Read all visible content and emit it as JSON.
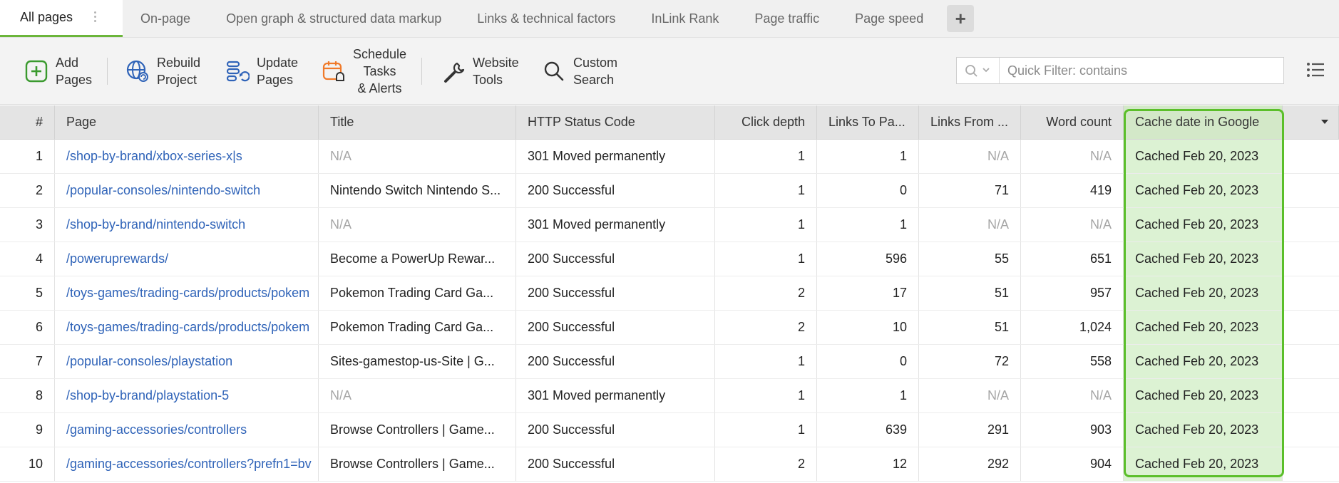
{
  "tabs": [
    {
      "label": "All pages",
      "active": true
    },
    {
      "label": "On-page"
    },
    {
      "label": "Open graph & structured data markup"
    },
    {
      "label": "Links & technical factors"
    },
    {
      "label": "InLink Rank"
    },
    {
      "label": "Page traffic"
    },
    {
      "label": "Page speed"
    }
  ],
  "toolbar": {
    "add_pages": [
      "Add",
      "Pages"
    ],
    "rebuild_project": [
      "Rebuild",
      "Project"
    ],
    "update_pages": [
      "Update",
      "Pages"
    ],
    "schedule": [
      "Schedule",
      "Tasks",
      "& Alerts"
    ],
    "website_tools": [
      "Website",
      "Tools"
    ],
    "custom_search": [
      "Custom",
      "Search"
    ],
    "filter_placeholder": "Quick Filter: contains"
  },
  "colors": {
    "accent": "#6bb53a",
    "link": "#2f63b8",
    "highlight_border": "#5bbf2a",
    "highlight_fill": "#dcf2d3"
  },
  "table": {
    "columns": [
      "#",
      "Page",
      "Title",
      "HTTP Status Code",
      "Click depth",
      "Links To Pa...",
      "Links From ...",
      "Word count",
      "Cache date in Google"
    ],
    "rows": [
      {
        "num": "1",
        "page": "/shop-by-brand/xbox-series-x|s",
        "title": "N/A",
        "http": "301 Moved permanently",
        "depth": "1",
        "lto": "1",
        "lfrom": "N/A",
        "wc": "N/A",
        "cache": "Cached Feb 20, 2023"
      },
      {
        "num": "2",
        "page": "/popular-consoles/nintendo-switch",
        "title": "Nintendo Switch Nintendo S...",
        "http": "200 Successful",
        "depth": "1",
        "lto": "0",
        "lfrom": "71",
        "wc": "419",
        "cache": "Cached Feb 20, 2023"
      },
      {
        "num": "3",
        "page": "/shop-by-brand/nintendo-switch",
        "title": "N/A",
        "http": "301 Moved permanently",
        "depth": "1",
        "lto": "1",
        "lfrom": "N/A",
        "wc": "N/A",
        "cache": "Cached Feb 20, 2023"
      },
      {
        "num": "4",
        "page": "/poweruprewards/",
        "title": "Become a PowerUp Rewar...",
        "http": "200 Successful",
        "depth": "1",
        "lto": "596",
        "lfrom": "55",
        "wc": "651",
        "cache": "Cached Feb 20, 2023"
      },
      {
        "num": "5",
        "page": "/toys-games/trading-cards/products/pokem",
        "title": "Pokemon Trading Card Ga...",
        "http": "200 Successful",
        "depth": "2",
        "lto": "17",
        "lfrom": "51",
        "wc": "957",
        "cache": "Cached Feb 20, 2023"
      },
      {
        "num": "6",
        "page": "/toys-games/trading-cards/products/pokem",
        "title": "Pokemon Trading Card Ga...",
        "http": "200 Successful",
        "depth": "2",
        "lto": "10",
        "lfrom": "51",
        "wc": "1,024",
        "cache": "Cached Feb 20, 2023"
      },
      {
        "num": "7",
        "page": "/popular-consoles/playstation",
        "title": "Sites-gamestop-us-Site | G...",
        "http": "200 Successful",
        "depth": "1",
        "lto": "0",
        "lfrom": "72",
        "wc": "558",
        "cache": "Cached Feb 20, 2023"
      },
      {
        "num": "8",
        "page": "/shop-by-brand/playstation-5",
        "title": "N/A",
        "http": "301 Moved permanently",
        "depth": "1",
        "lto": "1",
        "lfrom": "N/A",
        "wc": "N/A",
        "cache": "Cached Feb 20, 2023"
      },
      {
        "num": "9",
        "page": "/gaming-accessories/controllers",
        "title": "Browse Controllers | Game...",
        "http": "200 Successful",
        "depth": "1",
        "lto": "639",
        "lfrom": "291",
        "wc": "903",
        "cache": "Cached Feb 20, 2023"
      },
      {
        "num": "10",
        "page": "/gaming-accessories/controllers?prefn1=bv",
        "title": "Browse Controllers | Game...",
        "http": "200 Successful",
        "depth": "2",
        "lto": "12",
        "lfrom": "292",
        "wc": "904",
        "cache": "Cached Feb 20, 2023"
      }
    ]
  }
}
